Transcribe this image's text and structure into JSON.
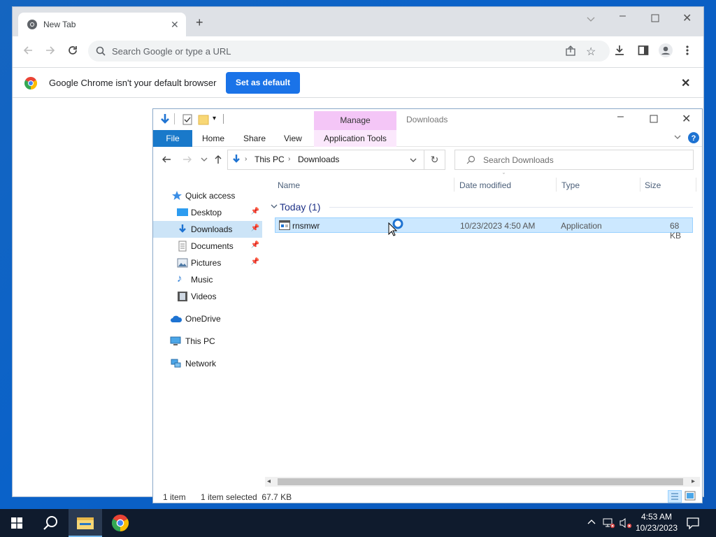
{
  "chrome": {
    "tab_title": "New Tab",
    "omnibox_placeholder": "Search Google or type a URL",
    "infobar_message": "Google Chrome isn't your default browser",
    "set_default_label": "Set as default"
  },
  "explorer": {
    "title": "Downloads",
    "contextual_tab": "Manage",
    "ribbon_tabs": {
      "file": "File",
      "home": "Home",
      "share": "Share",
      "view": "View",
      "app_tools": "Application Tools"
    },
    "breadcrumb": [
      "This PC",
      "Downloads"
    ],
    "search_placeholder": "Search Downloads",
    "nav_items": {
      "quick_access": "Quick access",
      "desktop": "Desktop",
      "downloads": "Downloads",
      "documents": "Documents",
      "pictures": "Pictures",
      "music": "Music",
      "videos": "Videos",
      "onedrive": "OneDrive",
      "this_pc": "This PC",
      "network": "Network"
    },
    "columns": {
      "name": "Name",
      "date": "Date modified",
      "type": "Type",
      "size": "Size"
    },
    "group_label": "Today (1)",
    "file": {
      "name": "rnsmwr",
      "date": "10/23/2023 4:50 AM",
      "type": "Application",
      "size": "68 KB"
    },
    "status": {
      "count": "1 item",
      "selection": "1 item selected  67.7 KB"
    }
  },
  "taskbar": {
    "time": "4:53 AM",
    "date": "10/23/2023"
  },
  "colors": {
    "accent": "#1a73e8",
    "manage_tab": "#f4c6f7",
    "selection": "#cce8ff",
    "taskbar": "#0f1b2d"
  }
}
